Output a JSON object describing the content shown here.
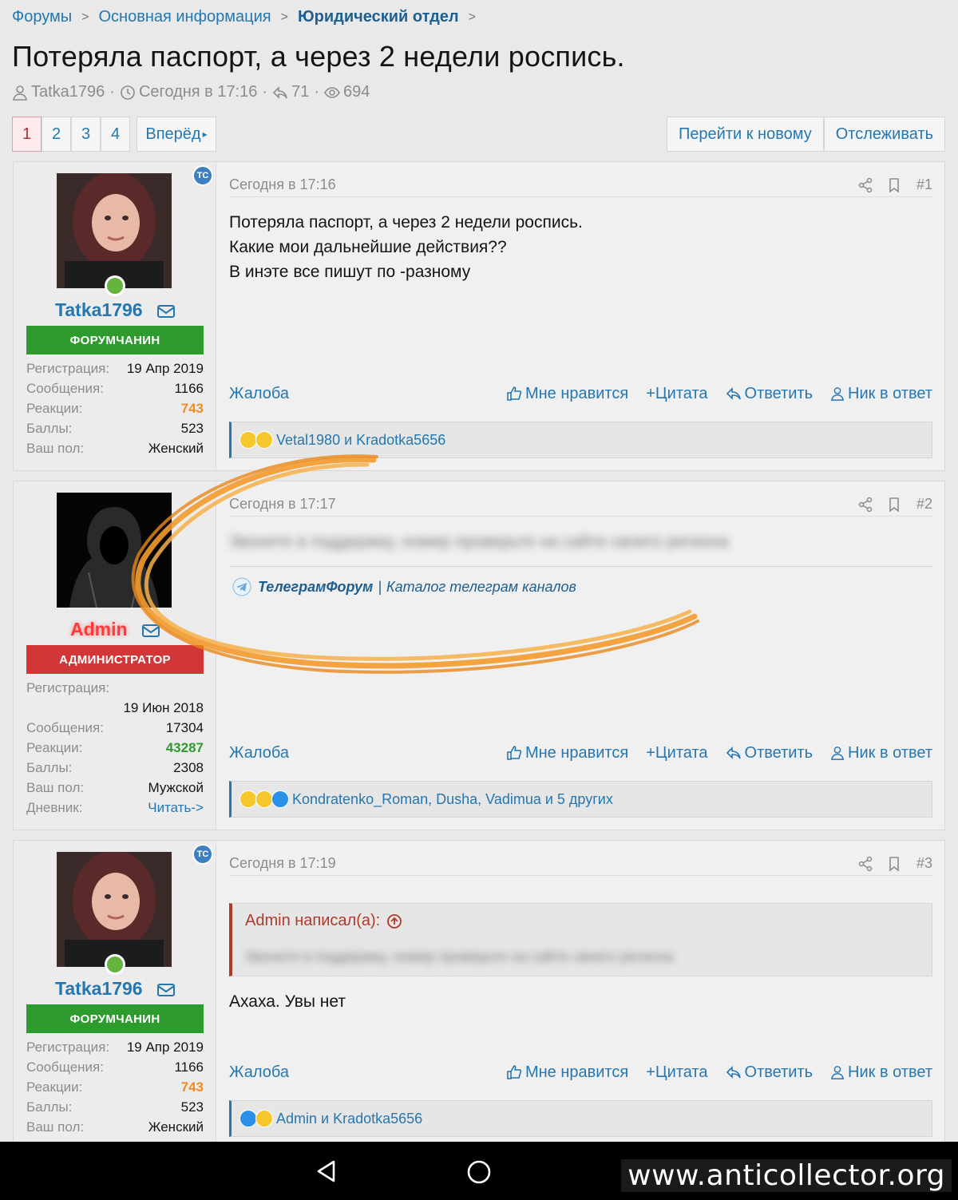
{
  "breadcrumb": [
    "Форумы",
    "Основная информация",
    "Юридический отдел"
  ],
  "thread": {
    "title": "Потеряла паспорт, а через 2 недели роспись.",
    "author": "Tatka1796",
    "date": "Сегодня в 17:16",
    "replies": "71",
    "views": "694"
  },
  "pagination": {
    "pages": [
      "1",
      "2",
      "3",
      "4"
    ],
    "active": "1",
    "next_label": "Вперёд"
  },
  "top_buttons": {
    "goto_new": "Перейти к новому",
    "watch": "Отслеживать"
  },
  "ts_badge": "ТС",
  "labels": {
    "registration": "Регистрация:",
    "messages": "Сообщения:",
    "reactions": "Реакции:",
    "points": "Баллы:",
    "gender": "Ваш пол:",
    "diary": "Дневник:"
  },
  "actions": {
    "report": "Жалоба",
    "like": "Мне нравится",
    "quote": "+Цитата",
    "reply": "Ответить",
    "nick": "Ник в ответ"
  },
  "posts": [
    {
      "user": {
        "name": "Tatka1796",
        "banner": "ФОРУМЧАНИН",
        "registration": "19 Апр 2019",
        "messages": "1166",
        "reactions": "743",
        "points": "523",
        "gender": "Женский"
      },
      "time": "Сегодня в 17:16",
      "number": "#1",
      "text": [
        "Потеряла паспорт, а через 2 недели роспись.",
        "Какие мои дальнейшие действия??",
        "В инэте все пишут по -разному"
      ],
      "reacted_by": "Vetal1980 и Kradotka5656"
    },
    {
      "user": {
        "name": "Admin",
        "banner": "АДМИНИСТРАТОР",
        "registration": "19 Июн 2018",
        "messages": "17304",
        "reactions": "43287",
        "points": "2308",
        "gender": "Мужской",
        "diary": "Читать->"
      },
      "time": "Сегодня в 17:17",
      "number": "#2",
      "text_blurred": "Звоните в поддержку, номер проверьте на сайте своего региона",
      "signature": {
        "brand": "ТелеграмФорум",
        "sep": "|",
        "text": "Каталог телеграм каналов"
      },
      "reacted_by": "Kondratenko_Roman, Dusha, Vadimua и 5 других"
    },
    {
      "user": {
        "name": "Tatka1796",
        "banner": "ФОРУМЧАНИН",
        "registration": "19 Апр 2019",
        "messages": "1166",
        "reactions": "743",
        "points": "523",
        "gender": "Женский"
      },
      "time": "Сегодня в 17:19",
      "number": "#3",
      "quote_head": "Admin написал(а):",
      "quote_blurred": "Звоните в поддержку, номер проверьте на сайте своего региона",
      "text": [
        "Ахаха. Увы нет"
      ],
      "reacted_by": "Admin и Kradotka5656"
    }
  ],
  "watermark": "www.anticollector.org",
  "colors": {
    "link": "#2577b1",
    "green_banner": "#2e9b2e",
    "red_banner": "#d33636",
    "accent_orange": "#f08c1c"
  }
}
